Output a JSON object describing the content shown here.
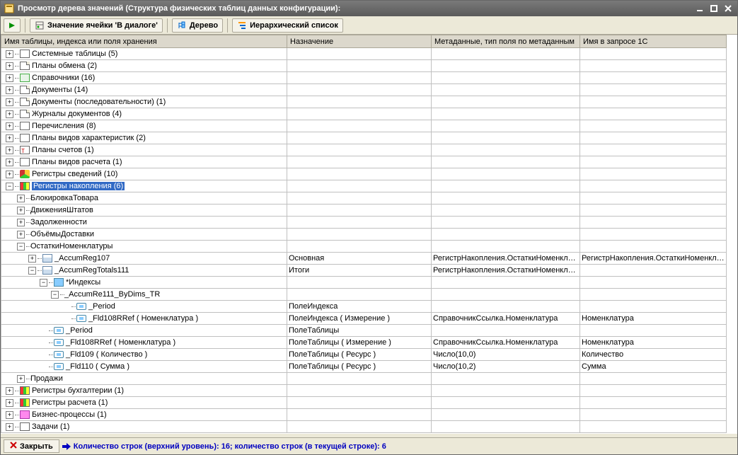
{
  "window": {
    "title": "Просмотр дерева значений (Структура физических таблиц данных конфигурации):"
  },
  "toolbar": {
    "run": "▶",
    "cell_value": "Значение ячейки 'В диалоге'",
    "tree": "Дерево",
    "hier_list": "Иерархический список"
  },
  "columns": {
    "c0": "Имя таблицы, индекса или поля хранения",
    "c1": "Назначение",
    "c2": "Метаданные, тип поля по метаданным",
    "c3": "Имя в запросе 1С"
  },
  "rows": [
    {
      "indent": 0,
      "expand": "+",
      "icon": "box",
      "label": "Системные таблицы (5)"
    },
    {
      "indent": 0,
      "expand": "+",
      "icon": "doc",
      "label": "Планы обмена (2)"
    },
    {
      "indent": 0,
      "expand": "+",
      "icon": "ref",
      "label": "Справочники (16)"
    },
    {
      "indent": 0,
      "expand": "+",
      "icon": "doc",
      "label": "Документы (14)"
    },
    {
      "indent": 0,
      "expand": "+",
      "icon": "doc",
      "label": "Документы (последовательности) (1)"
    },
    {
      "indent": 0,
      "expand": "+",
      "icon": "doc",
      "label": "Журналы документов (4)"
    },
    {
      "indent": 0,
      "expand": "+",
      "icon": "enum",
      "label": "Перечисления (8)"
    },
    {
      "indent": 0,
      "expand": "+",
      "icon": "enum",
      "label": "Планы видов характеристик (2)"
    },
    {
      "indent": 0,
      "expand": "+",
      "icon": "t",
      "label": "Планы счетов (1)"
    },
    {
      "indent": 0,
      "expand": "+",
      "icon": "enum",
      "label": "Планы видов расчета (1)"
    },
    {
      "indent": 0,
      "expand": "+",
      "icon": "yg",
      "label": "Регистры сведений (10)"
    },
    {
      "indent": 0,
      "expand": "-",
      "icon": "reg",
      "label": "Регистры накопления (6)",
      "selected": true
    },
    {
      "indent": 1,
      "expand": "+",
      "icon": "",
      "label": "БлокировкаТовара"
    },
    {
      "indent": 1,
      "expand": "+",
      "icon": "",
      "label": "ДвиженияШтатов"
    },
    {
      "indent": 1,
      "expand": "+",
      "icon": "",
      "label": "Задолженности"
    },
    {
      "indent": 1,
      "expand": "+",
      "icon": "",
      "label": "ОбъёмыДоставки"
    },
    {
      "indent": 1,
      "expand": "-",
      "icon": "",
      "label": "ОстаткиНоменклатуры"
    },
    {
      "indent": 2,
      "expand": "+",
      "icon": "table",
      "label": "_AccumReg107",
      "c1": "Основная",
      "c2": "РегистрНакопления.ОстаткиНоменклат...",
      "c3": "РегистрНакопления.ОстаткиНоменклат..."
    },
    {
      "indent": 2,
      "expand": "-",
      "icon": "table",
      "label": "_AccumRegTotals111",
      "c1": "Итоги",
      "c2": "РегистрНакопления.ОстаткиНоменклат..."
    },
    {
      "indent": 3,
      "expand": "-",
      "icon": "idx",
      "label": "*Индексы"
    },
    {
      "indent": 4,
      "expand": "-",
      "icon": "",
      "label": "_AccumRe111_ByDims_TR"
    },
    {
      "indent": 5,
      "expand": "",
      "icon": "field",
      "label": "_Period",
      "c1": "ПолеИндекса"
    },
    {
      "indent": 5,
      "expand": "",
      "icon": "field",
      "label": "_Fld108RRef ( Номенклатура )",
      "c1": "ПолеИндекса ( Измерение )",
      "c2": "СправочникСсылка.Номенклатура",
      "c3": "Номенклатура"
    },
    {
      "indent": 3,
      "expand": "",
      "icon": "field",
      "label": "_Period",
      "c1": "ПолеТаблицы"
    },
    {
      "indent": 3,
      "expand": "",
      "icon": "field",
      "label": "_Fld108RRef ( Номенклатура )",
      "c1": "ПолеТаблицы ( Измерение )",
      "c2": "СправочникСсылка.Номенклатура",
      "c3": "Номенклатура"
    },
    {
      "indent": 3,
      "expand": "",
      "icon": "field",
      "label": "_Fld109 ( Количество )",
      "c1": "ПолеТаблицы ( Ресурс )",
      "c2": "Число(10,0)",
      "c3": "Количество"
    },
    {
      "indent": 3,
      "expand": "",
      "icon": "field",
      "label": "_Fld110 ( Сумма )",
      "c1": "ПолеТаблицы ( Ресурс )",
      "c2": "Число(10,2)",
      "c3": "Сумма"
    },
    {
      "indent": 1,
      "expand": "+",
      "icon": "",
      "label": "Продажи"
    },
    {
      "indent": 0,
      "expand": "+",
      "icon": "reg",
      "label": "Регистры бухгалтерии (1)"
    },
    {
      "indent": 0,
      "expand": "+",
      "icon": "reg",
      "label": "Регистры расчета (1)"
    },
    {
      "indent": 0,
      "expand": "+",
      "icon": "bp",
      "label": "Бизнес-процессы (1)"
    },
    {
      "indent": 0,
      "expand": "+",
      "icon": "task",
      "label": "Задачи (1)"
    }
  ],
  "status": {
    "close": "Закрыть",
    "summary": "Количество строк (верхний уровень): 16; количество строк (в текущей строке): 6"
  },
  "col_widths": {
    "c0": 404,
    "c1": 204,
    "c2": 210,
    "c3": 207
  }
}
